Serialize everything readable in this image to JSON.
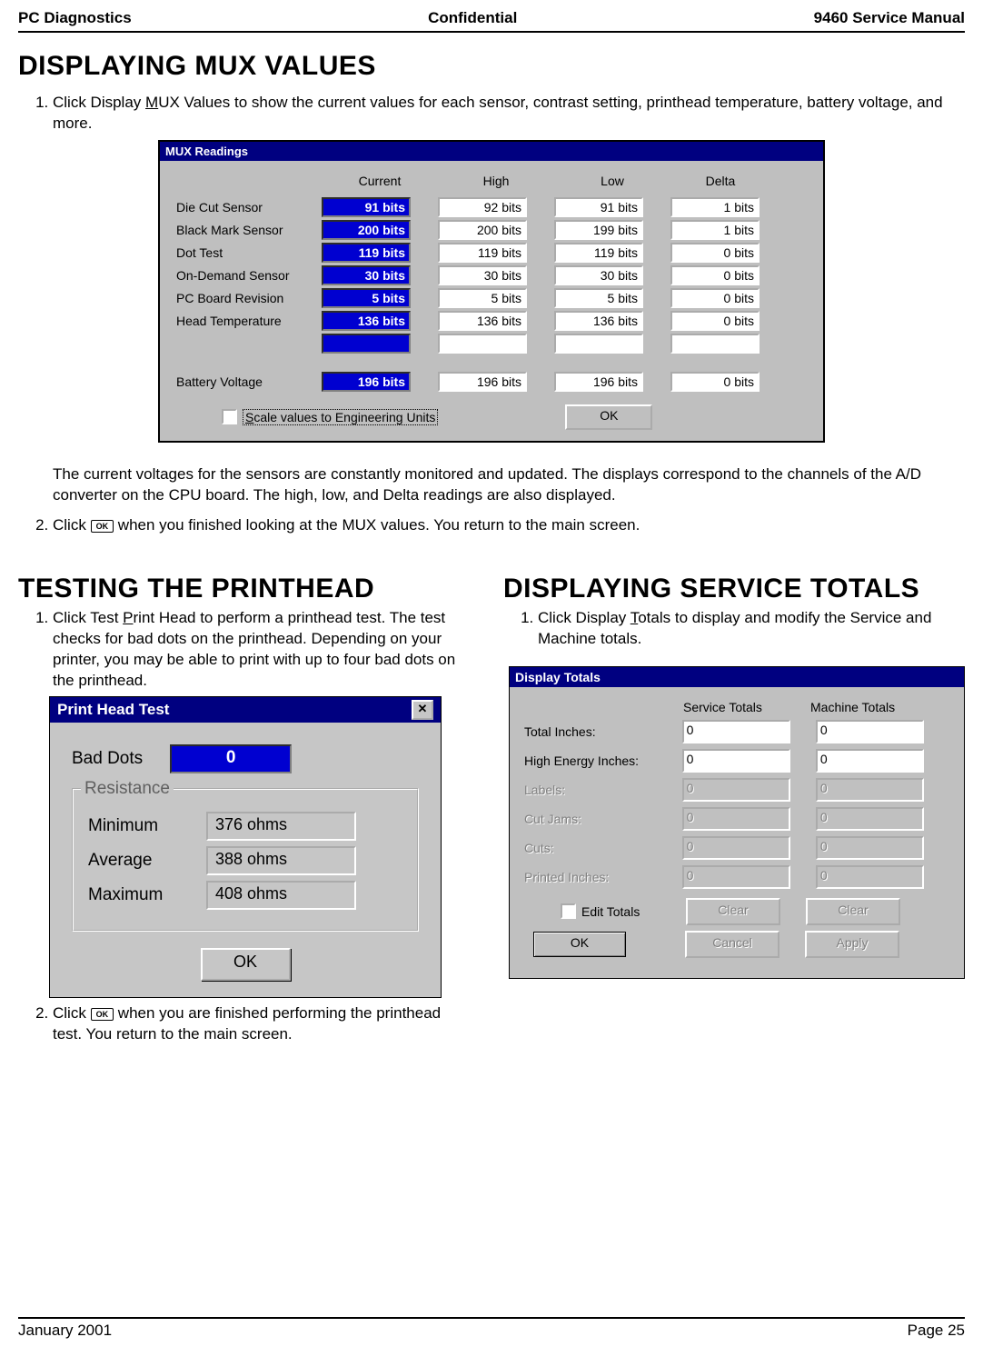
{
  "header": {
    "left": "PC Diagnostics",
    "center": "Confidential",
    "right": "9460 Service Manual"
  },
  "s1": {
    "title": "DISPLAYING MUX VALUES",
    "li1a": "Click Display ",
    "li1m": "M",
    "li1b": "UX Values to show the current values for each sensor, contrast setting, printhead temperature, battery voltage, and more.",
    "para": "The current voltages for the sensors are constantly monitored and updated.  The displays correspond to the channels of the A/D converter on the CPU board. The high, low, and Delta readings are also displayed.",
    "li2a": "Click ",
    "li2btn": "OK",
    "li2b": " when you finished looking at the MUX values.  You return to the main screen."
  },
  "mux": {
    "title": "MUX Readings",
    "h1": "Current",
    "h2": "High",
    "h3": "Low",
    "h4": "Delta",
    "rows": [
      {
        "label": "Die Cut Sensor",
        "cur": "91 bits",
        "high": "92 bits",
        "low": "91 bits",
        "delta": "1 bits"
      },
      {
        "label": "Black Mark Sensor",
        "cur": "200 bits",
        "high": "200 bits",
        "low": "199 bits",
        "delta": "1 bits"
      },
      {
        "label": "Dot Test",
        "cur": "119 bits",
        "high": "119 bits",
        "low": "119 bits",
        "delta": "0 bits"
      },
      {
        "label": "On-Demand Sensor",
        "cur": "30 bits",
        "high": "30 bits",
        "low": "30 bits",
        "delta": "0 bits"
      },
      {
        "label": "PC Board Revision",
        "cur": "5 bits",
        "high": "5 bits",
        "low": "5 bits",
        "delta": "0 bits"
      },
      {
        "label": "Head Temperature",
        "cur": "136 bits",
        "high": "136 bits",
        "low": "136 bits",
        "delta": "0 bits"
      }
    ],
    "blank": {
      "label": "",
      "cur": "",
      "high": "",
      "low": "",
      "delta": ""
    },
    "battery": {
      "label": "Battery Voltage",
      "cur": "196 bits",
      "high": "196 bits",
      "low": "196 bits",
      "delta": "0 bits"
    },
    "scale_pre": "S",
    "scale": "cale values to Engineering Units",
    "ok": "OK"
  },
  "s2": {
    "title": "TESTING THE PRINTHEAD",
    "li1a": "Click Test ",
    "li1m": "P",
    "li1b": "rint Head to perform a printhead test.  The test checks for bad dots on the printhead.  Depending on your printer, you may be able to print with up to four bad dots on the printhead.",
    "li2a": "Click ",
    "li2btn": "OK",
    "li2b": " when you are finished performing the printhead test.  You return to the main screen."
  },
  "pht": {
    "title": "Print Head Test",
    "bad": "Bad Dots",
    "badval": "0",
    "legend": "Resistance",
    "min_l": "Minimum",
    "min_v": "376 ohms",
    "avg_l": "Average",
    "avg_v": "388 ohms",
    "max_l": "Maximum",
    "max_v": "408 ohms",
    "ok": "OK"
  },
  "s3": {
    "title": "DISPLAYING SERVICE TOTALS",
    "li1a": "Click Display ",
    "li1m": "T",
    "li1b": "otals to display and modify the Service and Machine totals."
  },
  "dt": {
    "title": "Display Totals",
    "h1": "Service Totals",
    "h2": "Machine Totals",
    "rows": [
      {
        "label": "Total Inches:",
        "sv": "0",
        "mv": "0",
        "dis": false
      },
      {
        "label": "High Energy Inches:",
        "sv": "0",
        "mv": "0",
        "dis": false
      },
      {
        "label": "Labels:",
        "sv": "0",
        "mv": "0",
        "dis": true
      },
      {
        "label": "Cut Jams:",
        "sv": "0",
        "mv": "0",
        "dis": true
      },
      {
        "label": "Cuts:",
        "sv": "0",
        "mv": "0",
        "dis": true
      },
      {
        "label": "Printed Inches:",
        "sv": "0",
        "mv": "0",
        "dis": true
      }
    ],
    "edit": "Edit Totals",
    "clear": "Clear",
    "ok": "OK",
    "cancel": "Cancel",
    "apply": "Apply"
  },
  "footer": {
    "left": "January 2001",
    "right": "Page 25"
  }
}
